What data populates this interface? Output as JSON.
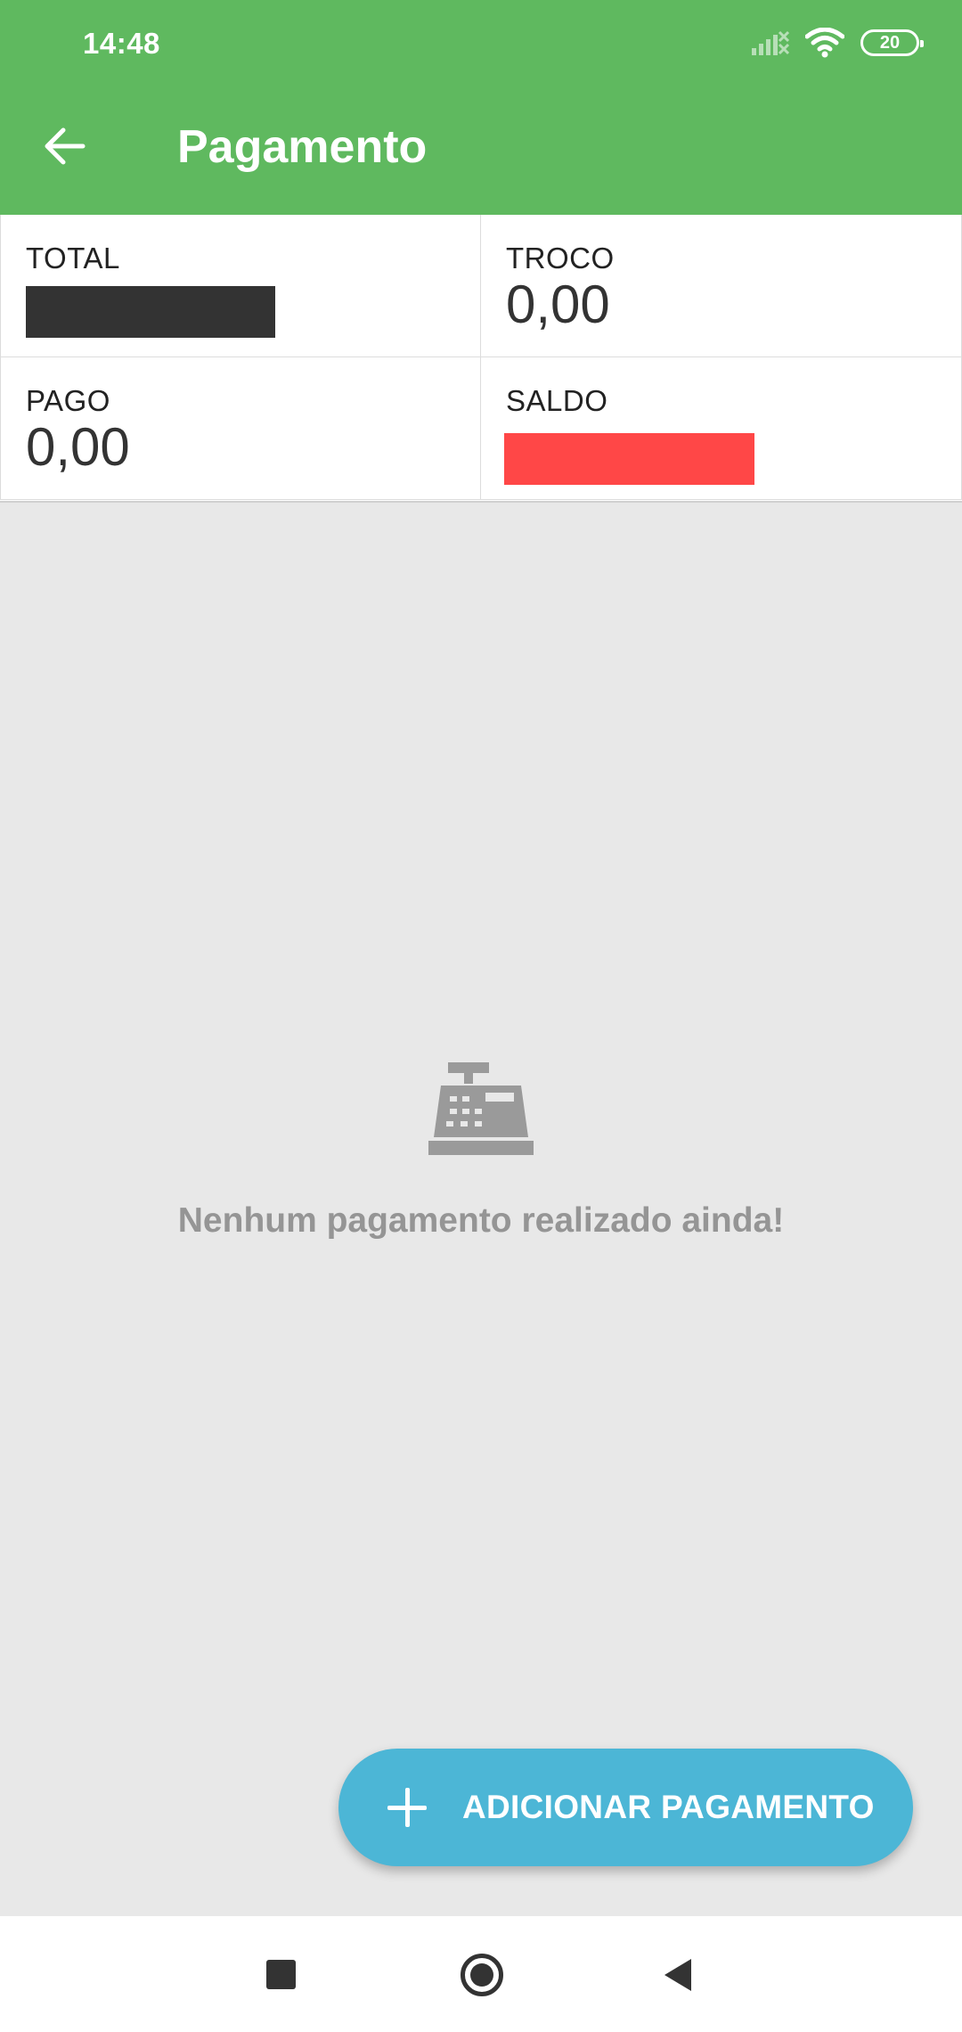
{
  "status_bar": {
    "time": "14:48",
    "battery": "20",
    "icons": [
      "signal-off-icon",
      "wifi-icon",
      "battery-icon"
    ]
  },
  "app_bar": {
    "title": "Pagamento",
    "back_icon": "arrow-back-icon",
    "color": "#5fb95f"
  },
  "summary": {
    "total": {
      "label": "TOTAL",
      "value": ""
    },
    "troco": {
      "label": "TROCO",
      "value": "0,00"
    },
    "pago": {
      "label": "PAGO",
      "value": "0,00"
    },
    "saldo": {
      "label": "SALDO",
      "value": ""
    },
    "redaction_colors": {
      "total": "#333333",
      "saldo": "#ff4747"
    }
  },
  "empty_state": {
    "icon": "cash-register-icon",
    "message": "Nenhum pagamento realizado ainda!"
  },
  "fab": {
    "label": "ADICIONAR PAGAMENTO",
    "icon": "plus-icon",
    "color": "#4cb6d6"
  },
  "nav_bar": {
    "icons": [
      "recent-apps-icon",
      "home-icon",
      "back-icon"
    ]
  }
}
